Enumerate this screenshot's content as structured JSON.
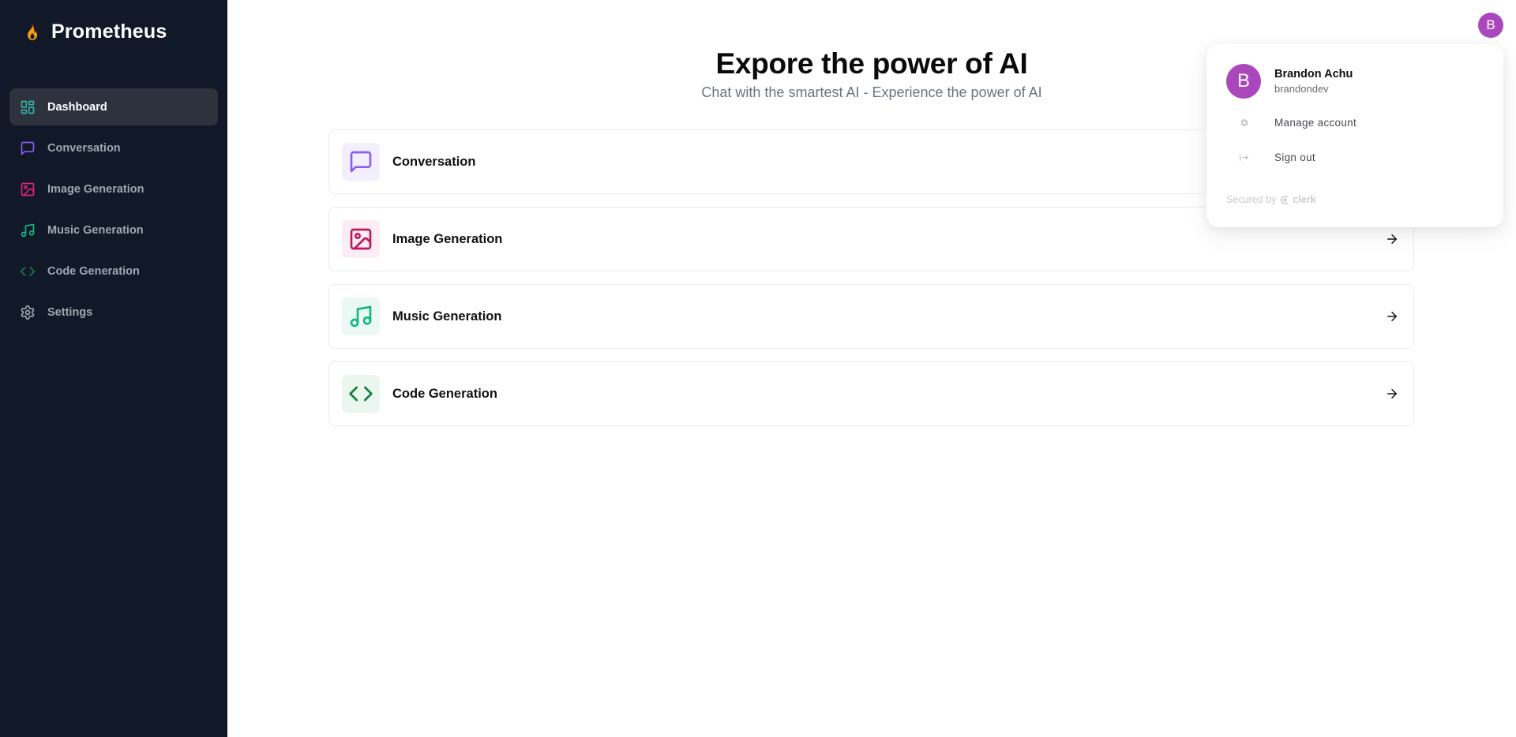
{
  "app": {
    "name": "Prometheus",
    "logo_icon": "flame-icon"
  },
  "sidebar": {
    "items": [
      {
        "label": "Dashboard",
        "icon": "layout-dashboard-icon",
        "color": "#34b3a0",
        "active": true
      },
      {
        "label": "Conversation",
        "icon": "message-square-icon",
        "color": "#8b5cf6"
      },
      {
        "label": "Image Generation",
        "icon": "image-icon",
        "color": "#db2777"
      },
      {
        "label": "Music Generation",
        "icon": "music-icon",
        "color": "#10b981"
      },
      {
        "label": "Code Generation",
        "icon": "code-icon",
        "color": "#15803d"
      },
      {
        "label": "Settings",
        "icon": "settings-icon",
        "color": "#a1a6b0"
      }
    ]
  },
  "main": {
    "title": "Expore the power of AI",
    "subtitle": "Chat with the smartest AI - Experience the power of AI",
    "cards": [
      {
        "label": "Conversation",
        "icon": "message-square-icon",
        "color": "#8b5cf6",
        "bg": "#f3effe"
      },
      {
        "label": "Image Generation",
        "icon": "image-icon",
        "color": "#be185d",
        "bg": "#fcecf3"
      },
      {
        "label": "Music Generation",
        "icon": "music-icon",
        "color": "#10b981",
        "bg": "#ebf8f3"
      },
      {
        "label": "Code Generation",
        "icon": "code-icon",
        "color": "#15803d",
        "bg": "#ebf6ef"
      }
    ]
  },
  "user_menu": {
    "avatar_initial": "B",
    "avatar_color": "#ab47bc",
    "name": "Brandon Achu",
    "username": "brandondev",
    "items": [
      {
        "label": "Manage account",
        "icon": "gear-icon"
      },
      {
        "label": "Sign out",
        "icon": "sign-out-icon"
      }
    ],
    "secured_by": "Secured by",
    "provider": "clerk"
  }
}
